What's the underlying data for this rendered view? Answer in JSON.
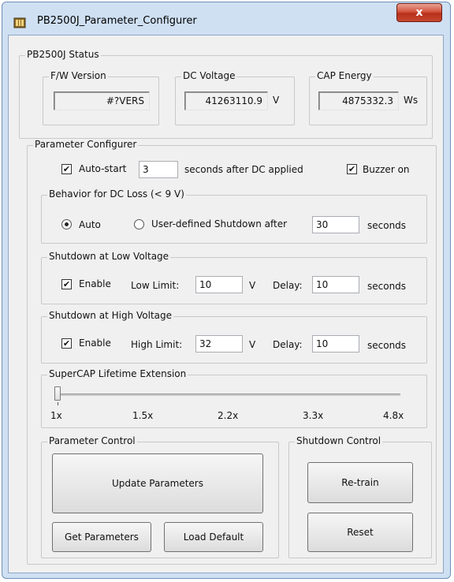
{
  "window": {
    "title": "PB2500J_Parameter_Configurer",
    "close_glyph": "x"
  },
  "status": {
    "group_label": "PB2500J Status",
    "fw": {
      "label": "F/W Version",
      "value": "#?VERS"
    },
    "dc": {
      "label": "DC Voltage",
      "value": "41263110.9",
      "unit": "V"
    },
    "cap": {
      "label": "CAP Energy",
      "value": "4875332.3",
      "unit": "Ws"
    }
  },
  "config": {
    "group_label": "Parameter Configurer",
    "autostart": {
      "label": "Auto-start",
      "value": "3",
      "suffix": "seconds after DC applied",
      "checked": true
    },
    "buzzer": {
      "label": "Buzzer on",
      "checked": true
    },
    "dcloss": {
      "group_label": "Behavior for DC Loss (< 9 V)",
      "auto_label": "Auto",
      "user_label": "User-defined Shutdown after",
      "value": "30",
      "suffix": "seconds",
      "selected": "Auto"
    },
    "lowv": {
      "group_label": "Shutdown at Low Voltage",
      "enable_label": "Enable",
      "limit_label": "Low Limit:",
      "limit_value": "10",
      "unit": "V",
      "delay_label": "Delay:",
      "delay_value": "10",
      "suffix": "seconds",
      "checked": true
    },
    "highv": {
      "group_label": "Shutdown at High Voltage",
      "enable_label": "Enable",
      "limit_label": "High Limit:",
      "limit_value": "32",
      "unit": "V",
      "delay_label": "Delay:",
      "delay_value": "10",
      "suffix": "seconds",
      "checked": true
    },
    "lifetime": {
      "group_label": "SuperCAP Lifetime Extension",
      "ticks": [
        "1x",
        "1.5x",
        "2.2x",
        "3.3x",
        "4.8x"
      ],
      "selected_index": 0
    }
  },
  "param_control": {
    "group_label": "Parameter Control",
    "update_label": "Update Parameters",
    "get_label": "Get Parameters",
    "default_label": "Load Default"
  },
  "shutdown_control": {
    "group_label": "Shutdown Control",
    "retrain_label": "Re-train",
    "reset_label": "Reset"
  },
  "icons": {
    "app": "app-window-icon",
    "check": "✔"
  }
}
